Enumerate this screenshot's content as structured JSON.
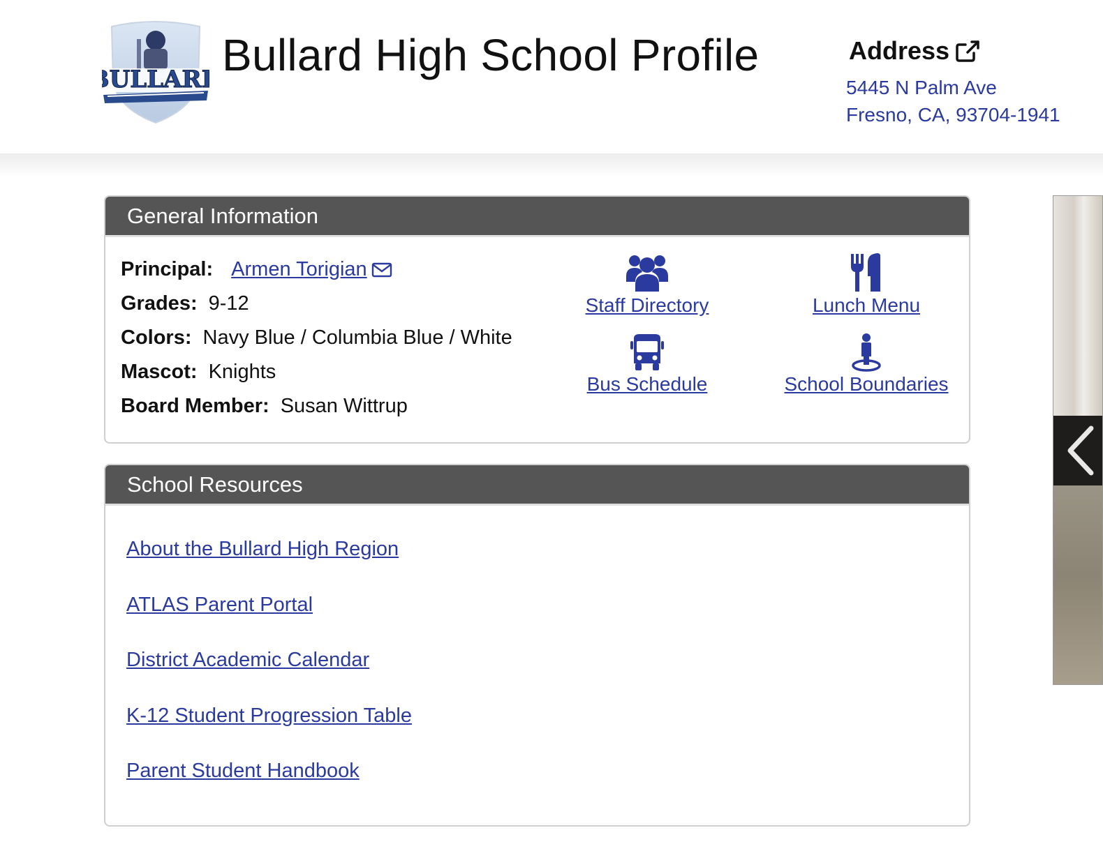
{
  "header": {
    "title": "Bullard High School Profile",
    "logo_text": "BULLARD",
    "address_heading": "Address",
    "address_line1": "5445 N Palm Ave",
    "address_line2": "Fresno, CA, 93704-1941"
  },
  "general": {
    "heading": "General Information",
    "principal_label": "Principal:",
    "principal_name": "Armen Torigian",
    "grades_label": "Grades:",
    "grades_value": "9-12",
    "colors_label": "Colors:",
    "colors_value": "Navy Blue / Columbia Blue / White",
    "mascot_label": "Mascot:",
    "mascot_value": "Knights",
    "board_label": "Board Member:",
    "board_value": "Susan Wittrup",
    "quick_links": {
      "staff": "Staff Directory",
      "lunch": "Lunch Menu",
      "bus": "Bus Schedule",
      "boundaries": "School Boundaries"
    }
  },
  "resources": {
    "heading": "School Resources",
    "links": [
      "About the Bullard High Region",
      "ATLAS Parent Portal",
      "District Academic Calendar",
      "K-12 Student Progression Table",
      "Parent Student Handbook"
    ]
  },
  "colors": {
    "link": "#2a3a9e",
    "panel_header": "#555555"
  }
}
